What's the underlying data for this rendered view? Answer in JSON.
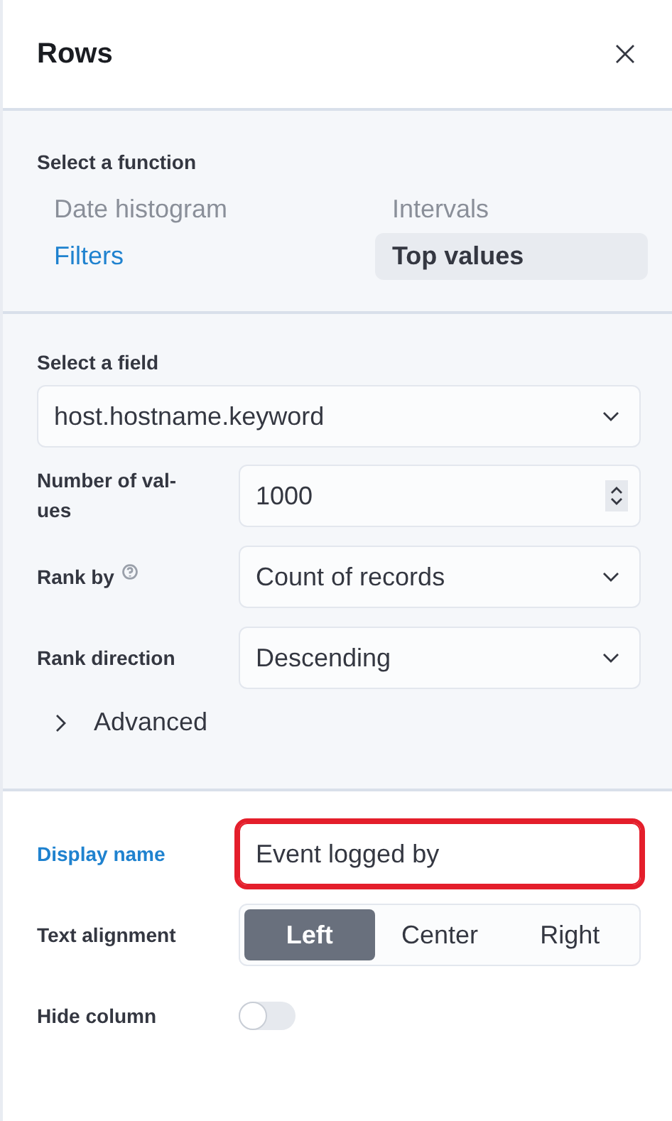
{
  "panel": {
    "title": "Rows"
  },
  "function_section": {
    "label": "Select a function",
    "functions": [
      {
        "label": "Date histogram",
        "selected": false,
        "focused": false
      },
      {
        "label": "Intervals",
        "selected": false,
        "focused": false
      },
      {
        "label": "Filters",
        "selected": false,
        "focused": true
      },
      {
        "label": "Top values",
        "selected": true,
        "focused": false
      }
    ]
  },
  "field_section": {
    "field": {
      "label": "Select a field",
      "value": "host.hostname.keyword"
    },
    "rows": [
      {
        "kind": "number",
        "label": "Number of val-\nues",
        "value": "1000",
        "help": false
      },
      {
        "kind": "select",
        "label": "Rank by",
        "value": "Count of records",
        "help": true
      },
      {
        "kind": "select",
        "label": "Rank direction",
        "value": "Descending",
        "help": false
      }
    ],
    "advanced": {
      "label": "Advanced",
      "expanded": false
    }
  },
  "display_section": {
    "display_name": {
      "label": "Display name",
      "value": "Event logged by",
      "focused": true,
      "highlighted": true
    },
    "text_alignment": {
      "label": "Text alignment",
      "options": [
        {
          "label": "Left",
          "selected": true
        },
        {
          "label": "Center",
          "selected": false
        },
        {
          "label": "Right",
          "selected": false
        }
      ]
    },
    "hide_column": {
      "label": "Hide column",
      "on": false
    }
  }
}
